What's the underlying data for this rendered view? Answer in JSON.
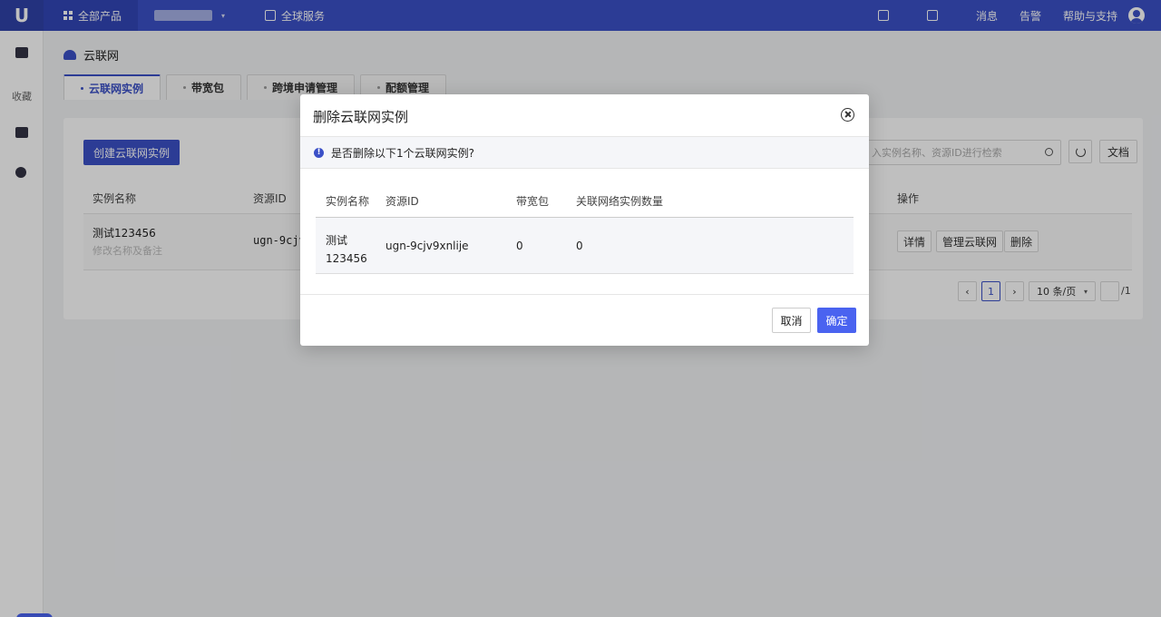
{
  "topbar": {
    "logo": "U",
    "all_products": "全部产品",
    "global_service": "全球服务",
    "messages": "消息",
    "alerts": "告警",
    "help": "帮助与支持"
  },
  "sidebar": {
    "favorites": "收藏"
  },
  "page": {
    "title": "云联网",
    "tabs": [
      {
        "label": "云联网实例",
        "active": true
      },
      {
        "label": "带宽包"
      },
      {
        "label": "跨境申请管理"
      },
      {
        "label": "配额管理"
      }
    ]
  },
  "toolbar": {
    "create_label": "创建云联网实例",
    "search_placeholder": "入实例名称、资源ID进行检索",
    "doc_label": "文档"
  },
  "table": {
    "columns": [
      "实例名称",
      "资源ID",
      "操作"
    ],
    "rows": [
      {
        "name": "测试123456",
        "sub": "修改名称及备注",
        "id": "ugn-9cjv",
        "actions": [
          "详情",
          "管理云联网",
          "删除"
        ]
      }
    ]
  },
  "pagination": {
    "prev": "‹",
    "current": "1",
    "next": "›",
    "page_size": "10 条/页",
    "total": "/1"
  },
  "modal": {
    "title": "删除云联网实例",
    "warning": "是否删除以下1个云联网实例?",
    "columns": [
      "实例名称",
      "资源ID",
      "带宽包",
      "关联网络实例数量"
    ],
    "row": {
      "name_line1": "测试",
      "name_line2": "123456",
      "id": "ugn-9cjv9xnlije",
      "bandwidth": "0",
      "linked_count": "0"
    },
    "cancel_label": "取消",
    "confirm_label": "确定"
  },
  "colors": {
    "brand": "#3b50c7",
    "primary_button": "#4a63f0"
  }
}
